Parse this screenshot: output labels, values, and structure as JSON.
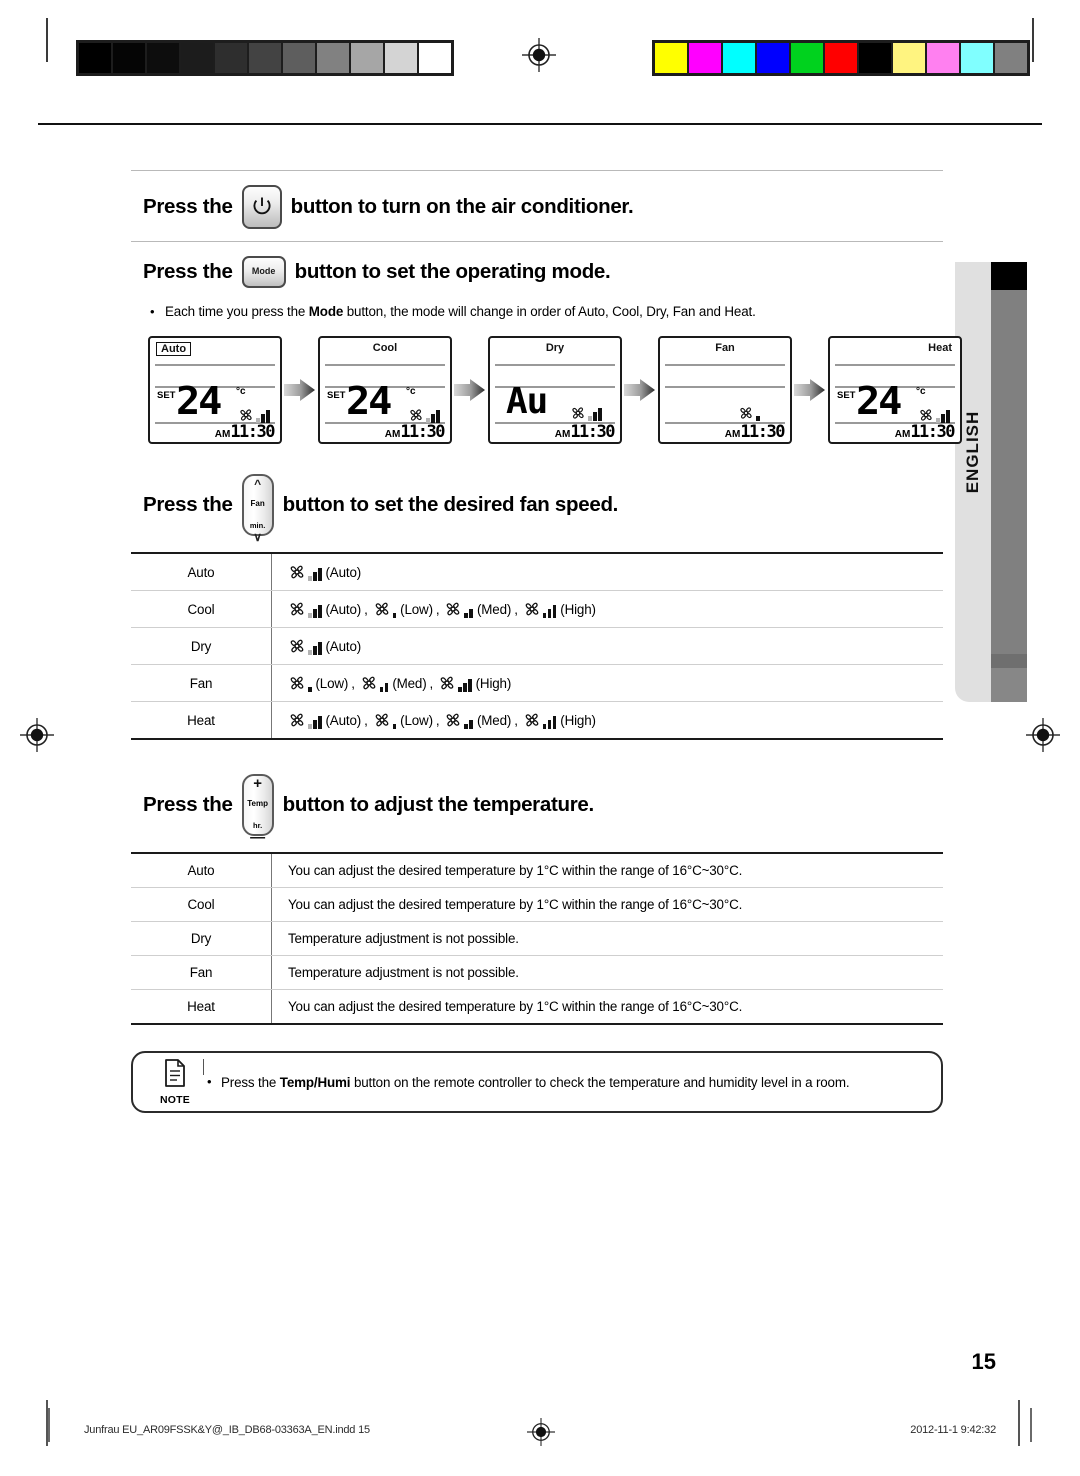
{
  "page": {
    "number": "15",
    "language_tab": "ENGLISH"
  },
  "sections": [
    {
      "id": "power",
      "pre_text": "Press the",
      "button": {
        "name": "power-button",
        "label": ""
      },
      "post_text": "button to turn on the air conditioner."
    },
    {
      "id": "mode",
      "pre_text": "Press the",
      "button": {
        "name": "mode-button",
        "label": "Mode"
      },
      "post_text": "button to set the operating mode.",
      "bullet": {
        "before": "Each time you press the ",
        "bold": "Mode",
        "after": " button, the mode will change in order of Auto, Cool, Dry, Fan and Heat."
      }
    },
    {
      "id": "fanspeed",
      "pre_text": "Press the",
      "button": {
        "name": "fan-button",
        "label_top": "Fan",
        "label_bottom": "min."
      },
      "post_text": "button to set the desired fan speed."
    },
    {
      "id": "temperature",
      "pre_text": "Press the",
      "button": {
        "name": "temp-button",
        "label_top": "Temp",
        "label_bottom": "hr.",
        "plus": "+",
        "minus": "—"
      },
      "post_text": "button to adjust the temperature."
    }
  ],
  "lcd_panels": [
    {
      "mode_label": "Auto",
      "label_style": "boxed",
      "set_label": "SET",
      "temp": "24",
      "unit": "°c",
      "big_text": "",
      "fan_bars": [
        "dim",
        "on",
        "on"
      ],
      "show_fan": true,
      "am_label": "AM",
      "clock": "11:30"
    },
    {
      "mode_label": "Cool",
      "label_style": "center",
      "set_label": "SET",
      "temp": "24",
      "unit": "°c",
      "big_text": "",
      "fan_bars": [
        "dim",
        "on",
        "on"
      ],
      "show_fan": true,
      "am_label": "AM",
      "clock": "11:30"
    },
    {
      "mode_label": "Dry",
      "label_style": "center",
      "set_label": "",
      "temp": "",
      "unit": "",
      "big_text": "Au",
      "fan_bars": [
        "dim",
        "on",
        "on"
      ],
      "show_fan": true,
      "am_label": "AM",
      "clock": "11:30"
    },
    {
      "mode_label": "Fan",
      "label_style": "center",
      "set_label": "",
      "temp": "",
      "unit": "",
      "big_text": "",
      "fan_bars": [
        "on"
      ],
      "show_fan": true,
      "am_label": "AM",
      "clock": "11:30"
    },
    {
      "mode_label": "Heat",
      "label_style": "right",
      "set_label": "SET",
      "temp": "24",
      "unit": "°c",
      "big_text": "",
      "fan_bars": [
        "dim",
        "on",
        "on"
      ],
      "show_fan": true,
      "am_label": "AM",
      "clock": "11:30"
    }
  ],
  "fan_speed_table": [
    {
      "mode": "Auto",
      "speeds": [
        {
          "label": "(Auto)",
          "bars": [
            "dim",
            "on",
            "on"
          ]
        }
      ]
    },
    {
      "mode": "Cool",
      "speeds": [
        {
          "label": "(Auto)",
          "bars": [
            "dim",
            "on",
            "on"
          ]
        },
        {
          "label": "(Low)",
          "bars": [
            "on"
          ]
        },
        {
          "label": "(Med)",
          "bars": [
            "on",
            "on"
          ]
        },
        {
          "label": "(High)",
          "bars": [
            "on",
            "on",
            "on"
          ]
        }
      ]
    },
    {
      "mode": "Dry",
      "speeds": [
        {
          "label": "(Auto)",
          "bars": [
            "dim",
            "on",
            "on"
          ]
        }
      ]
    },
    {
      "mode": "Fan",
      "speeds": [
        {
          "label": "(Low)",
          "bars": [
            "on"
          ]
        },
        {
          "label": "(Med)",
          "bars": [
            "on",
            "on"
          ]
        },
        {
          "label": "(High)",
          "bars": [
            "on",
            "on",
            "on"
          ]
        }
      ]
    },
    {
      "mode": "Heat",
      "speeds": [
        {
          "label": "(Auto)",
          "bars": [
            "dim",
            "on",
            "on"
          ]
        },
        {
          "label": "(Low)",
          "bars": [
            "on"
          ]
        },
        {
          "label": "(Med)",
          "bars": [
            "on",
            "on"
          ]
        },
        {
          "label": "(High)",
          "bars": [
            "on",
            "on",
            "on"
          ]
        }
      ]
    }
  ],
  "temperature_table": [
    {
      "mode": "Auto",
      "text": "You can adjust the desired temperature by 1°C within the range of 16°C~30°C."
    },
    {
      "mode": "Cool",
      "text": "You can adjust the desired temperature by 1°C within the range of 16°C~30°C."
    },
    {
      "mode": "Dry",
      "text": "Temperature adjustment is not possible."
    },
    {
      "mode": "Fan",
      "text": "Temperature adjustment is not possible."
    },
    {
      "mode": "Heat",
      "text": "You can adjust the desired temperature by 1°C within the range of 16°C~30°C."
    }
  ],
  "note": {
    "icon_label": "NOTE",
    "before": "Press the ",
    "bold": "Temp/Humi",
    "after": " button on the remote controller to check the temperature and humidity level in a room."
  },
  "footer": {
    "file": "Junfrau EU_AR09FSSK&Y@_IB_DB68-03363A_EN.indd   15",
    "timestamp": "2012-11-1   9:42:32"
  },
  "calibration": {
    "gray_swatches": [
      "#000000",
      "#050505",
      "#0d0d0d",
      "#1c1c1c",
      "#2e2e2e",
      "#434343",
      "#5e5e5e",
      "#818181",
      "#a6a6a6",
      "#d4d4d4",
      "#ffffff"
    ],
    "color_swatches": [
      "#ffff00",
      "#ff00ff",
      "#00ffff",
      "#0000ff",
      "#00d21e",
      "#ff0000",
      "#000000",
      "#fff480",
      "#ff80f0",
      "#80ffff",
      "#808080"
    ]
  }
}
